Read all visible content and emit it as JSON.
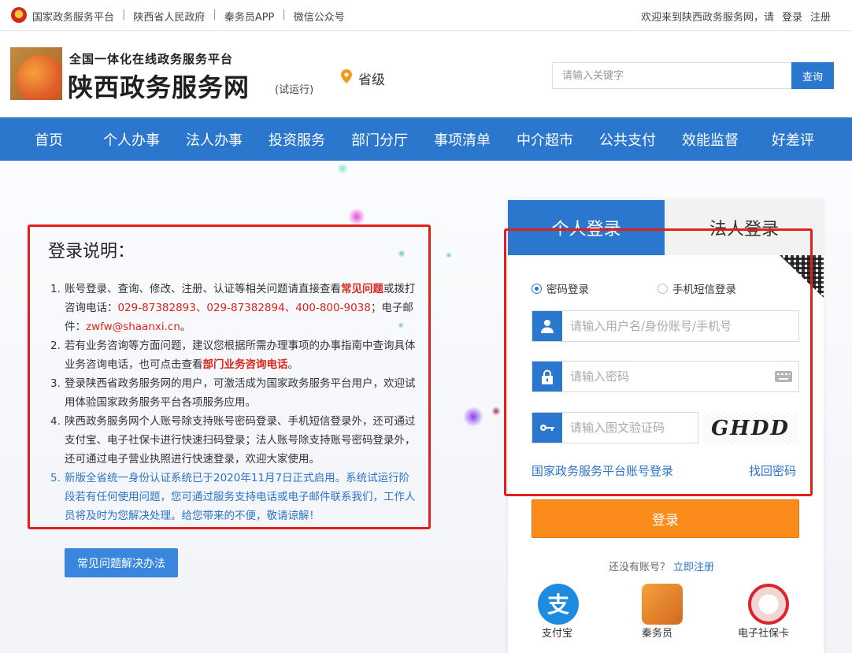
{
  "topbar": {
    "links": [
      "国家政务服务平台",
      "陕西省人民政府",
      "秦务员APP",
      "微信公众号"
    ],
    "welcome": "欢迎来到陕西政务服务网，请",
    "login": "登录",
    "register": "注册"
  },
  "header": {
    "subtitle": "全国一体化在线政务服务平台",
    "title": "陕西政务服务网",
    "trial": "(试运行)",
    "province": "省级",
    "search_placeholder": "请输入关键字",
    "search_button": "查询"
  },
  "nav": [
    "首页",
    "个人办事",
    "法人办事",
    "投资服务",
    "部门分厅",
    "事项清单",
    "中介超市",
    "公共支付",
    "效能监督",
    "好差评"
  ],
  "info": {
    "title": "登录说明：",
    "item1": {
      "num": "1.",
      "a": "账号登录、查询、修改、注册、认证等相关问题请直接查看",
      "link": "常见问题",
      "b": "或拨打咨询电话：",
      "phones": "029-87382893、029-87382894、400-800-9038",
      "c": "；电子邮件：",
      "email": "zwfw@shaanxi.cn",
      "d": "。"
    },
    "item2": {
      "num": "2.",
      "a": "若有业务咨询等方面问题，建议您根据所需办理事项的办事指南中查询具体业务咨询电话，也可点击查看",
      "link": "部门业务咨询电话",
      "b": "。"
    },
    "item3": {
      "num": "3.",
      "text": "登录陕西省政务服务网的用户，可激活成为国家政务服务平台用户，欢迎试用体验国家政务服务平台各项服务应用。"
    },
    "item4": {
      "num": "4.",
      "text": "陕西政务服务网个人账号除支持账号密码登录、手机短信登录外，还可通过支付宝、电子社保卡进行快速扫码登录；法人账号除支持账号密码登录外，还可通过电子营业执照进行快速登录，欢迎大家使用。"
    },
    "item5": {
      "num": "5.",
      "text": "新版全省统一身份认证系统已于2020年11月7日正式启用。系统试运行阶段若有任何使用问题，您可通过服务支持电话或电子邮件联系我们，工作人员将及时为您解决处理。给您带来的不便，敬请谅解！"
    },
    "faq_button": "常见问题解决办法"
  },
  "login": {
    "tab_personal": "个人登录",
    "tab_corporate": "法人登录",
    "mode_password": "密码登录",
    "mode_sms": "手机短信登录",
    "username_placeholder": "请输入用户名/身份账号/手机号",
    "password_placeholder": "请输入密码",
    "captcha_placeholder": "请输入图文验证码",
    "captcha_text": "GHDD",
    "national_link": "国家政务服务平台账号登录",
    "recover_link": "找回密码",
    "submit": "登录",
    "no_account": "还没有账号？",
    "register_link": "立即注册",
    "alt": [
      "支付宝",
      "秦务员",
      "电子社保卡"
    ]
  },
  "colors": {
    "primary": "#2b77ce",
    "login_button": "#fb8c1c",
    "highlight_red": "#d9261c",
    "frame_red": "#e0201b"
  }
}
